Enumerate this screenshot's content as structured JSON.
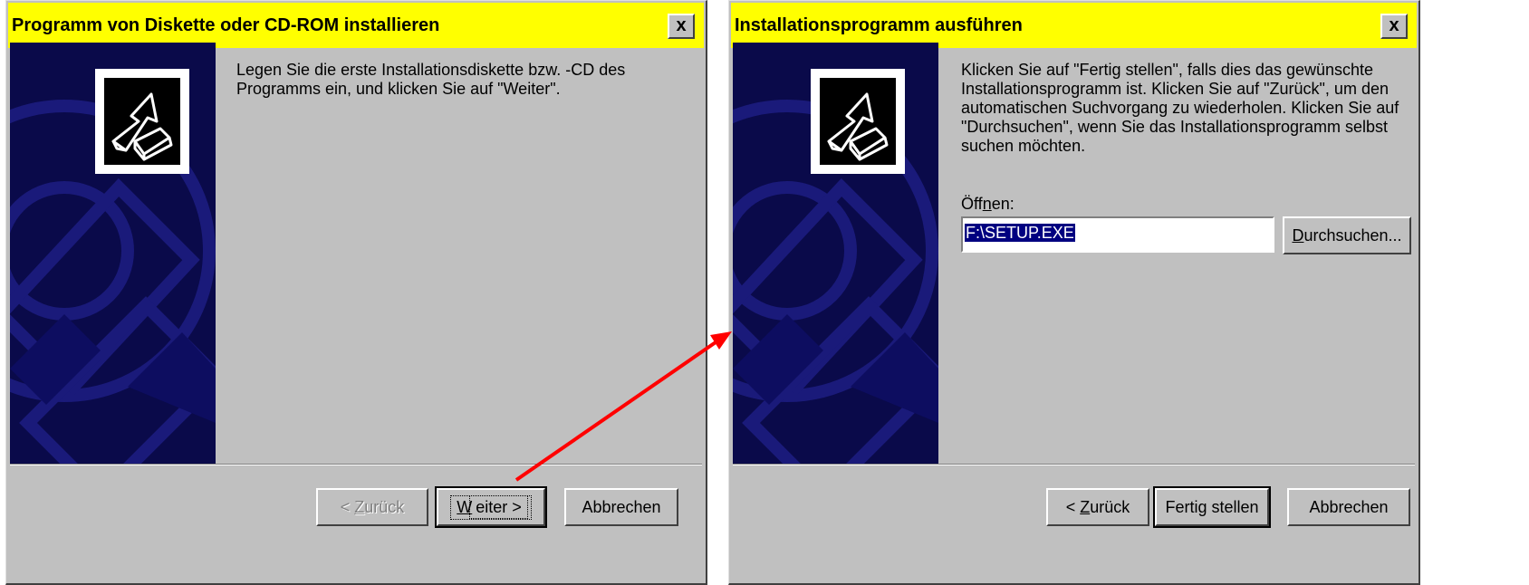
{
  "dialog1": {
    "title": "Programm von Diskette oder CD-ROM installieren",
    "close": "x",
    "message": "Legen Sie die erste Installationsdiskette bzw. -CD des Programms ein, und klicken Sie auf \"Weiter\".",
    "buttons": {
      "back_prefix": "< ",
      "back_mnemonic": "Z",
      "back_rest": "urück",
      "back_enabled": "false",
      "next_mnemonic": "W",
      "next_rest": "eiter >",
      "cancel": "Abbrechen"
    }
  },
  "dialog2": {
    "title": "Installationsprogramm ausführen",
    "close": "x",
    "message": "Klicken Sie auf \"Fertig stellen\", falls dies das gewünschte Installationsprogramm ist. Klicken Sie auf \"Zurück\", um den automatischen Suchvorgang zu wiederholen. Klicken Sie auf \"Durchsuchen\", wenn Sie das Installationsprogramm selbst suchen möchten.",
    "open_label_pre": "Öff",
    "open_label_mnemonic": "n",
    "open_label_post": "en:",
    "open_value": "F:\\SETUP.EXE",
    "browse_mnemonic": "D",
    "browse_rest": "urchsuchen...",
    "buttons": {
      "back_prefix": "< ",
      "back_mnemonic": "Z",
      "back_rest": "urück",
      "finish": "Fertig stellen",
      "cancel": "Abbrechen"
    }
  },
  "colors": {
    "title_bar": "#ffff00",
    "dialog_face": "#c0c0c0",
    "banner": "#0a0a4a",
    "selection": "#000080",
    "annotation_arrow": "#ff0000"
  },
  "icons": [
    "setup-wizard-icon",
    "close-icon"
  ]
}
